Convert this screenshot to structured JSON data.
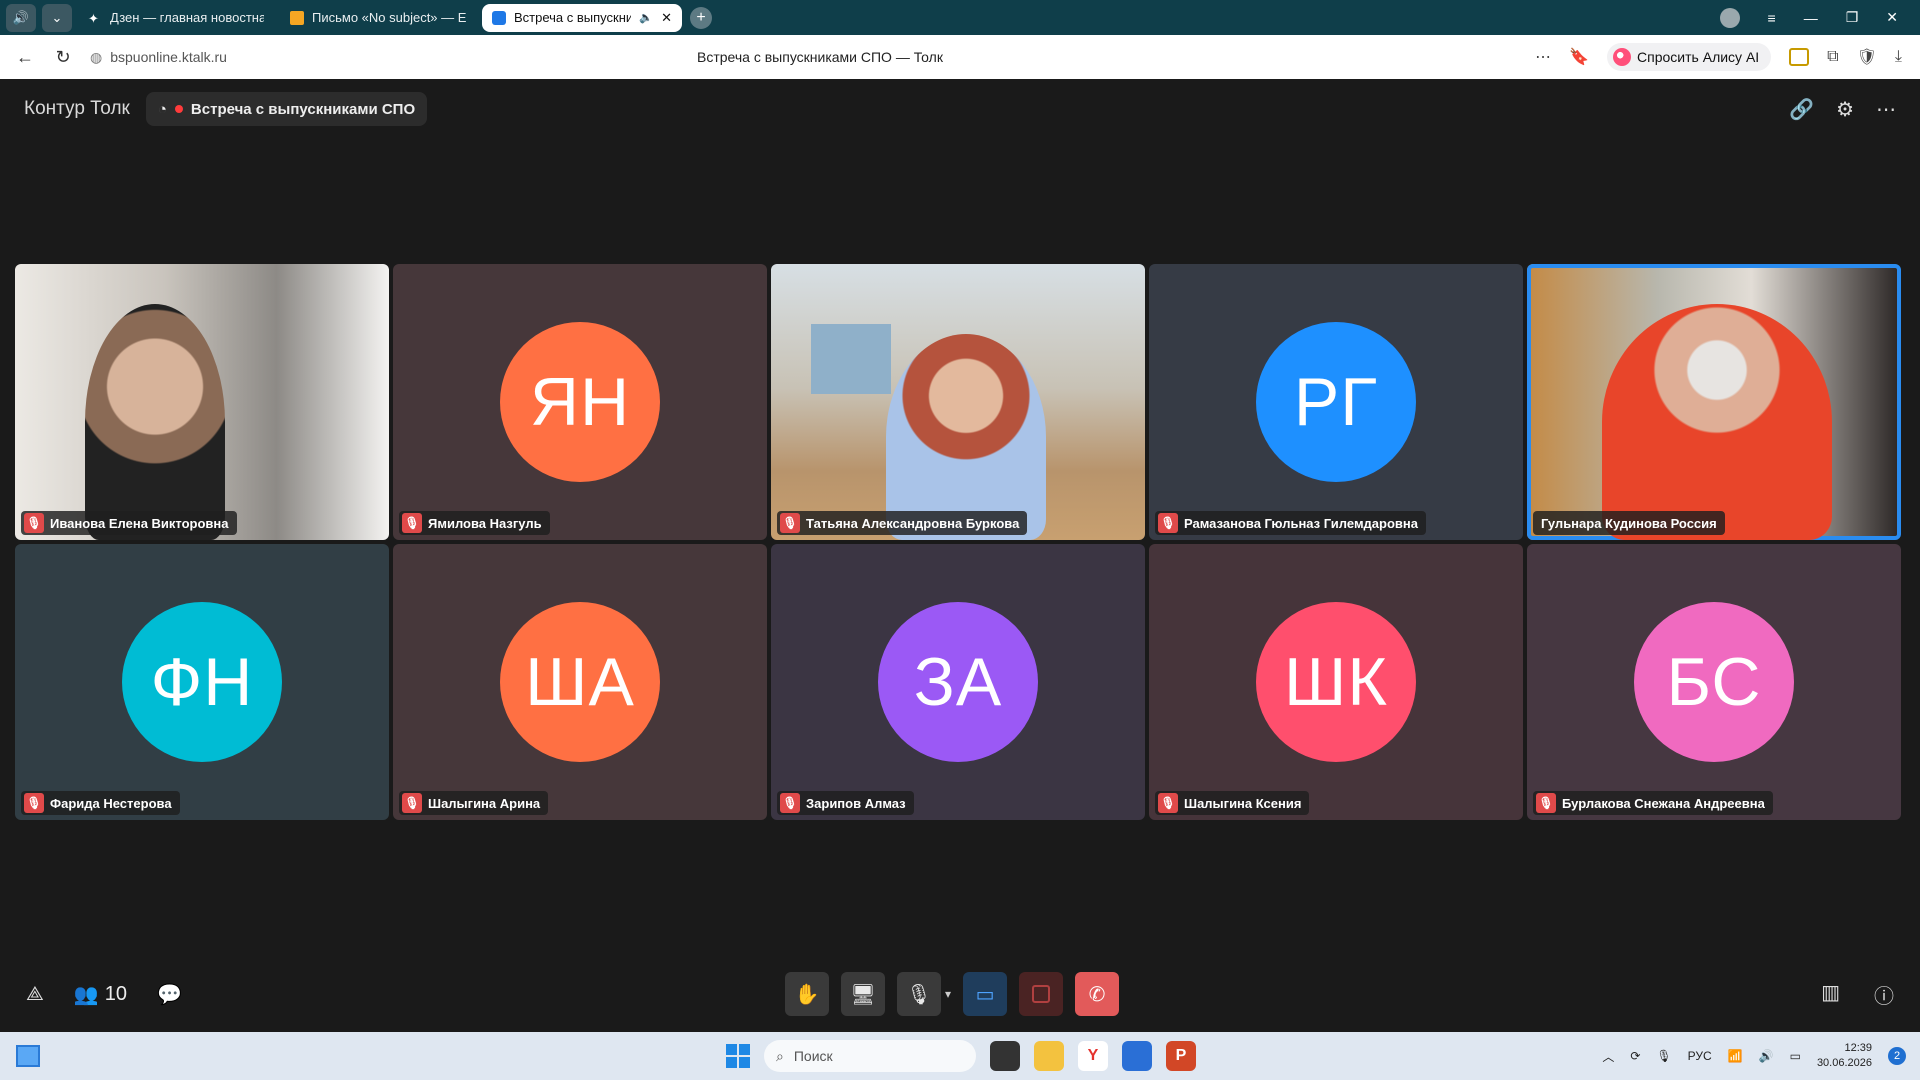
{
  "browser": {
    "tabs": [
      {
        "label": "Дзен — главная новостна",
        "active": false
      },
      {
        "label": "Письмо «No subject» — E",
        "active": false
      },
      {
        "label": "Встреча с выпускни",
        "active": true
      }
    ],
    "url": "bspuonline.ktalk.ru",
    "page_title": "Встреча с выпускниками СПО — Толк",
    "alice_label": "Спросить Алису AI"
  },
  "app": {
    "brand": "Контур Толк",
    "meeting_title": "Встреча с выпускниками СПО",
    "participant_count": "10"
  },
  "participants": [
    {
      "name": "Иванова Елена Викторовна",
      "initials": "",
      "color": "",
      "mic_muted": true,
      "video": true
    },
    {
      "name": "Ямилова Назгуль",
      "initials": "ЯН",
      "color": "#ff7043",
      "tile_bg": "#46373a",
      "mic_muted": true,
      "video": false
    },
    {
      "name": "Татьяна Александровна Буркова",
      "initials": "",
      "color": "",
      "mic_muted": true,
      "video": true
    },
    {
      "name": "Рамазанова Гюльназ Гилемдаровна",
      "initials": "РГ",
      "color": "#1e90ff",
      "tile_bg": "#363b45",
      "mic_muted": true,
      "video": false
    },
    {
      "name": "Гульнара Кудинова Россия",
      "initials": "",
      "color": "",
      "mic_muted": false,
      "video": true,
      "speaking": true
    },
    {
      "name": "Фарида Нестерова",
      "initials": "ФН",
      "color": "#00bcd4",
      "tile_bg": "#313e45",
      "mic_muted": true,
      "video": false
    },
    {
      "name": "Шалыгина Арина",
      "initials": "ША",
      "color": "#ff7043",
      "tile_bg": "#46373a",
      "mic_muted": true,
      "video": false
    },
    {
      "name": "Зарипов Алмаз",
      "initials": "ЗА",
      "color": "#9b59f5",
      "tile_bg": "#3b3543",
      "mic_muted": true,
      "video": false
    },
    {
      "name": "Шалыгина Ксения",
      "initials": "ШК",
      "color": "#ff4f6d",
      "tile_bg": "#46343a",
      "mic_muted": true,
      "video": false
    },
    {
      "name": "Бурлакова Снежана Андреевна",
      "initials": "БС",
      "color": "#f06ac0",
      "tile_bg": "#463741",
      "mic_muted": true,
      "video": false
    }
  ],
  "taskbar": {
    "search_placeholder": "Поиск",
    "language": "РУС",
    "time": "12:39",
    "date": "30.06.2026",
    "notifications": "2"
  }
}
